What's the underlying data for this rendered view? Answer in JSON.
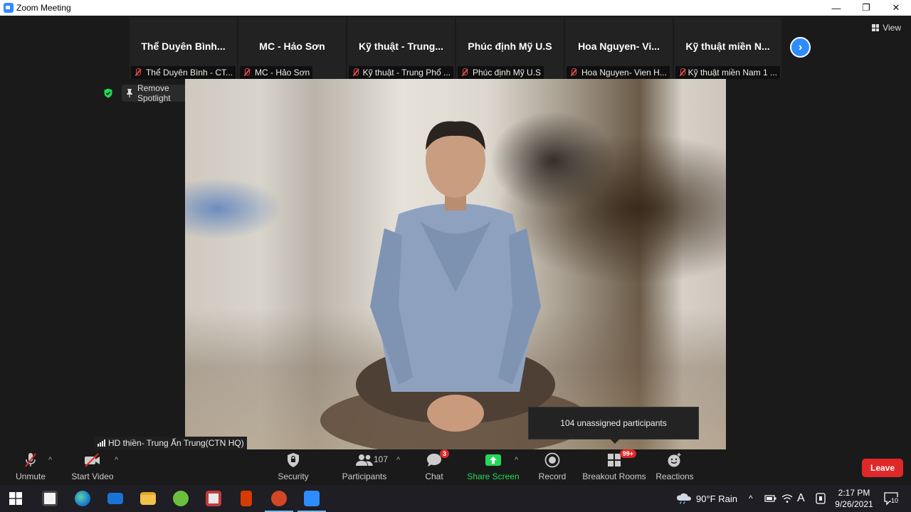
{
  "window": {
    "title": "Zoom Meeting",
    "minimize": "—",
    "restore": "❐",
    "close": "✕"
  },
  "view_button": {
    "label": "View"
  },
  "participants_strip": [
    {
      "big": "Thể Duyên Bình...",
      "small": "Thể Duyên Bình - CT..."
    },
    {
      "big": "MC - Hảo Sơn",
      "small": "MC - Hảo Sơn"
    },
    {
      "big": "Kỹ thuật - Trung...",
      "small": "Kỹ thuật - Trung Phổ ..."
    },
    {
      "big": "Phúc định Mỹ U.S",
      "small": "Phúc định Mỹ U.S"
    },
    {
      "big": "Hoa Nguyen- Vi...",
      "small": "Hoa Nguyen- Vien H..."
    },
    {
      "big": "Kỹ thuật miền N...",
      "small": "Kỹ thuật miền Nam 1 ..."
    }
  ],
  "next_button": {
    "label": "›"
  },
  "spotlight": {
    "label": "Remove Spotlight"
  },
  "video": {
    "name_tag": "HD thiền- Trung Ấn Trung(CTN HQ)"
  },
  "tooltip": {
    "text": "104 unassigned participants"
  },
  "toolbar": {
    "unmute": "Unmute",
    "start_video": "Start Video",
    "security": "Security",
    "participants": "Participants",
    "participants_count": "107",
    "chat": "Chat",
    "chat_badge": "3",
    "share_screen": "Share Screen",
    "record": "Record",
    "breakout_rooms": "Breakout Rooms",
    "breakout_badge": "99+",
    "reactions": "Reactions",
    "leave": "Leave",
    "caret": "^"
  },
  "taskbar": {
    "weather": "90°F  Rain",
    "time": "2:17 PM",
    "date": "9/26/2021",
    "notifications": "10",
    "lang": "A"
  },
  "colors": {
    "accent": "#2d8cff",
    "leave": "#e02828",
    "share": "#23d959"
  }
}
